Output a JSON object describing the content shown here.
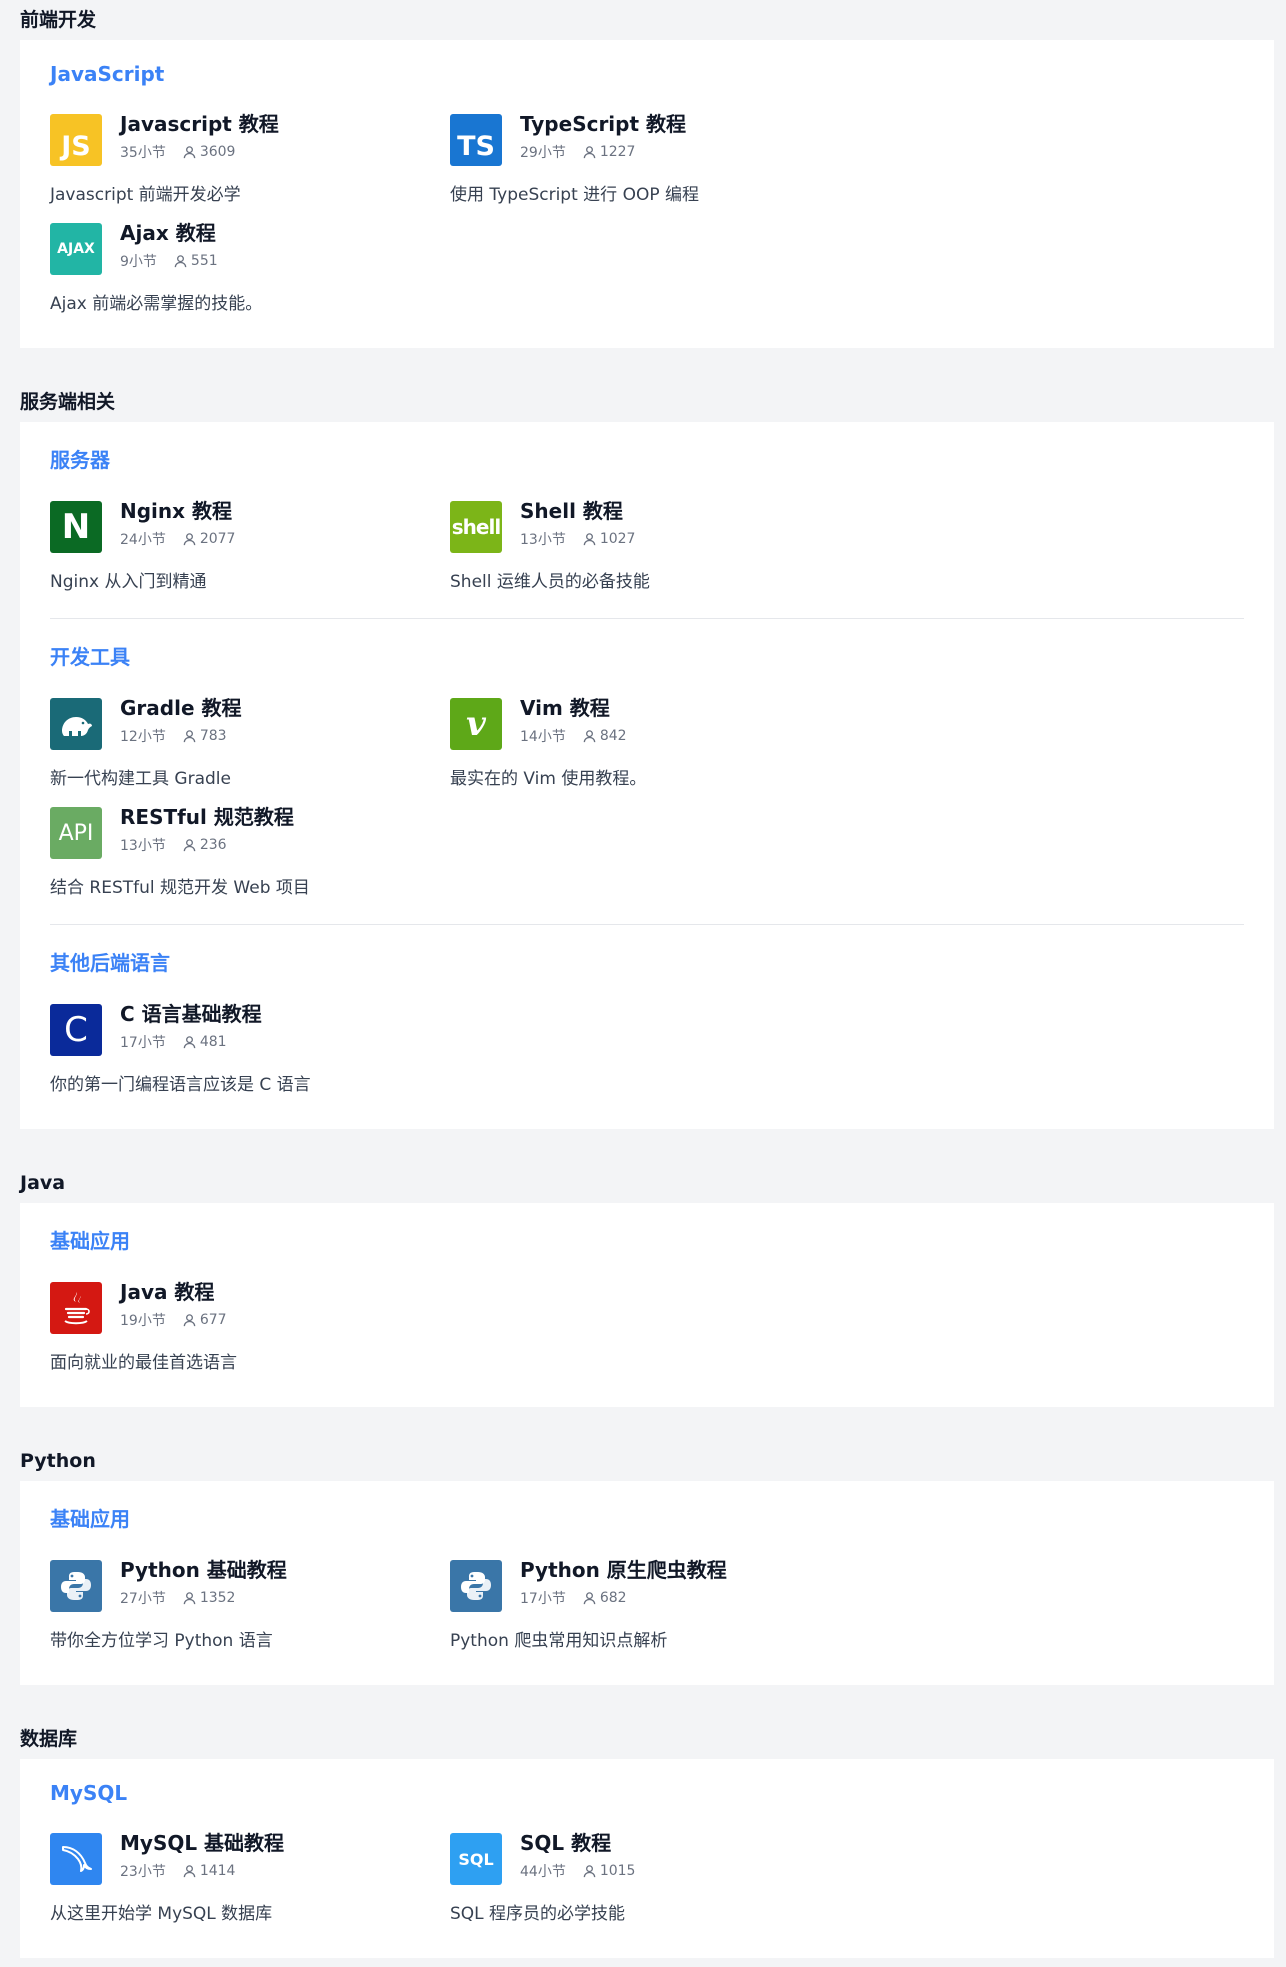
{
  "sections": [
    {
      "title": "前端开发",
      "groups": [
        {
          "title": "JavaScript",
          "courses": [
            {
              "name": "Javascript 教程",
              "lessons": "35小节",
              "learners": "3609",
              "desc": "Javascript 前端开发必学",
              "icon": "js-icon",
              "icon_text": "JS",
              "icon_bg": "#f7c325",
              "icon_fg": "#ffffff"
            },
            {
              "name": "TypeScript 教程",
              "lessons": "29小节",
              "learners": "1227",
              "desc": "使用 TypeScript 进行 OOP 编程",
              "icon": "ts-icon",
              "icon_text": "TS",
              "icon_bg": "#1976d2",
              "icon_fg": "#ffffff"
            },
            {
              "name": "Ajax 教程",
              "lessons": "9小节",
              "learners": "551",
              "desc": "Ajax 前端必需掌握的技能。",
              "icon": "ajax-icon",
              "icon_text": "AJAX",
              "icon_bg": "#22b5a5",
              "icon_fg": "#ffffff"
            }
          ]
        }
      ]
    },
    {
      "title": "服务端相关",
      "groups": [
        {
          "title": "服务器",
          "courses": [
            {
              "name": "Nginx 教程",
              "lessons": "24小节",
              "learners": "2077",
              "desc": "Nginx 从入门到精通",
              "icon": "nginx-icon",
              "icon_text": "N",
              "icon_bg": "#0b6a24",
              "icon_fg": "#ffffff"
            },
            {
              "name": "Shell 教程",
              "lessons": "13小节",
              "learners": "1027",
              "desc": "Shell 运维人员的必备技能",
              "icon": "shell-icon",
              "icon_text": "shell",
              "icon_bg": "#7cb518",
              "icon_fg": "#ffffff"
            }
          ]
        },
        {
          "title": "开发工具",
          "courses": [
            {
              "name": "Gradle 教程",
              "lessons": "12小节",
              "learners": "783",
              "desc": "新一代构建工具 Gradle",
              "icon": "gradle-elephant-icon",
              "icon_text": "",
              "icon_bg": "#1a6a77",
              "icon_fg": "#ffffff"
            },
            {
              "name": "Vim 教程",
              "lessons": "14小节",
              "learners": "842",
              "desc": "最实在的 Vim 使用教程。",
              "icon": "vim-icon",
              "icon_text": "v",
              "icon_bg": "#5ea818",
              "icon_fg": "#ffffff"
            },
            {
              "name": "RESTful 规范教程",
              "lessons": "13小节",
              "learners": "236",
              "desc": "结合 RESTful 规范开发 Web 项目",
              "icon": "api-icon",
              "icon_text": "API",
              "icon_bg": "#6aab63",
              "icon_fg": "#ffffff"
            }
          ]
        },
        {
          "title": "其他后端语言",
          "courses": [
            {
              "name": "C 语言基础教程",
              "lessons": "17小节",
              "learners": "481",
              "desc": "你的第一门编程语言应该是 C 语言",
              "icon": "c-icon",
              "icon_text": "C",
              "icon_bg": "#0a2a9a",
              "icon_fg": "#ffffff"
            }
          ]
        }
      ]
    },
    {
      "title": "Java",
      "groups": [
        {
          "title": "基础应用",
          "courses": [
            {
              "name": "Java 教程",
              "lessons": "19小节",
              "learners": "677",
              "desc": "面向就业的最佳首选语言",
              "icon": "java-coffee-icon",
              "icon_text": "",
              "icon_bg": "#d41812",
              "icon_fg": "#ffffff"
            }
          ]
        }
      ]
    },
    {
      "title": "Python",
      "groups": [
        {
          "title": "基础应用",
          "courses": [
            {
              "name": "Python 基础教程",
              "lessons": "27小节",
              "learners": "1352",
              "desc": "带你全方位学习 Python 语言",
              "icon": "python-icon",
              "icon_text": "",
              "icon_bg": "#3a76a8",
              "icon_fg": "#ffffff"
            },
            {
              "name": "Python 原生爬虫教程",
              "lessons": "17小节",
              "learners": "682",
              "desc": "Python 爬虫常用知识点解析",
              "icon": "python-icon",
              "icon_text": "",
              "icon_bg": "#3a76a8",
              "icon_fg": "#ffffff"
            }
          ]
        }
      ]
    },
    {
      "title": "数据库",
      "groups": [
        {
          "title": "MySQL",
          "courses": [
            {
              "name": "MySQL 基础教程",
              "lessons": "23小节",
              "learners": "1414",
              "desc": "从这里开始学 MySQL 数据库",
              "icon": "mysql-dolphin-icon",
              "icon_text": "",
              "icon_bg": "#2f86f0",
              "icon_fg": "#ffffff"
            },
            {
              "name": "SQL 教程",
              "lessons": "44小节",
              "learners": "1015",
              "desc": "SQL 程序员的必学技能",
              "icon": "sql-icon",
              "icon_text": "SQL",
              "icon_bg": "#2ea0f2",
              "icon_fg": "#ffffff"
            }
          ]
        }
      ]
    }
  ]
}
